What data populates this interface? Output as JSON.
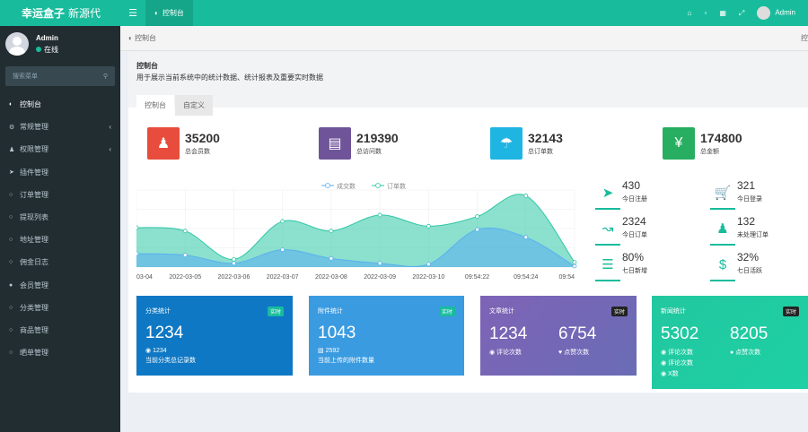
{
  "brand": {
    "name_bold": "幸运盒子",
    "name_light": "新源代"
  },
  "topbar": {
    "tab_label": "控制台",
    "user": "Admin"
  },
  "user": {
    "name": "Admin",
    "status": "在线"
  },
  "search": {
    "placeholder": "搜索菜单"
  },
  "sidebar": {
    "items": [
      {
        "label": "控制台",
        "icon": "dashboard-icon",
        "arrow": ""
      },
      {
        "label": "常规管理",
        "icon": "cogs-icon",
        "arrow": "‹"
      },
      {
        "label": "权限管理",
        "icon": "group-icon",
        "arrow": "‹"
      },
      {
        "label": "插件管理",
        "icon": "rocket-icon",
        "arrow": ""
      },
      {
        "label": "订单管理",
        "icon": "circle-icon",
        "arrow": ""
      },
      {
        "label": "提现列表",
        "icon": "circle-icon",
        "arrow": ""
      },
      {
        "label": "地址管理",
        "icon": "circle-icon",
        "arrow": ""
      },
      {
        "label": "佣金日志",
        "icon": "circle-icon",
        "arrow": ""
      },
      {
        "label": "会员管理",
        "icon": "user-icon",
        "arrow": ""
      },
      {
        "label": "分类管理",
        "icon": "circle-icon",
        "arrow": ""
      },
      {
        "label": "商品管理",
        "icon": "circle-icon",
        "arrow": ""
      },
      {
        "label": "晒单管理",
        "icon": "circle-icon",
        "arrow": ""
      }
    ]
  },
  "breadcrumb": {
    "label": "控制台",
    "right": "控"
  },
  "panel": {
    "title": "控制台",
    "desc": "用于展示当前系统中的统计数据、统计报表及重要实时数据",
    "tabs": [
      "控制台",
      "自定义"
    ]
  },
  "stats": [
    {
      "value": "35200",
      "label": "总会员数",
      "color": "#e74c3c",
      "icon": "users-icon"
    },
    {
      "value": "219390",
      "label": "总访问数",
      "color": "#6f5499",
      "icon": "book-icon"
    },
    {
      "value": "32143",
      "label": "总订单数",
      "color": "#1fb5e3",
      "icon": "shopping-bag-icon"
    },
    {
      "value": "174800",
      "label": "总金额",
      "color": "#27ae60",
      "icon": "yen-icon"
    }
  ],
  "chart_data": {
    "type": "area",
    "legend": [
      "成交数",
      "订单数"
    ],
    "x": [
      "03-04",
      "2022-03-05",
      "2022-03-06",
      "2022-03-07",
      "2022-03-08",
      "2022-03-09",
      "2022-03-10",
      "09:54:22",
      "09:54:24",
      "09:54"
    ],
    "series": [
      {
        "name": "成交数",
        "values": [
          28,
          25,
          8,
          36,
          18,
          8,
          6,
          78,
          62,
          2
        ],
        "color": "#5ab1ef"
      },
      {
        "name": "订单数",
        "values": [
          82,
          75,
          16,
          95,
          75,
          108,
          85,
          105,
          148,
          10
        ],
        "color": "#2ec7a5"
      }
    ],
    "ylim": [
      0,
      160
    ]
  },
  "mini_stats": [
    {
      "value": "430",
      "label": "今日注册",
      "icon": "rocket-icon"
    },
    {
      "value": "321",
      "label": "今日登录",
      "icon": "cart-icon"
    },
    {
      "value": "2324",
      "label": "今日订单",
      "icon": "line-chart-icon"
    },
    {
      "value": "132",
      "label": "未处理订单",
      "icon": "users-icon"
    },
    {
      "value": "80%",
      "label": "七日新增",
      "icon": "list-icon"
    },
    {
      "value": "32%",
      "label": "七日活跃",
      "icon": "dollar-icon"
    }
  ],
  "cards": [
    {
      "title": "分类统计",
      "badge": "实时",
      "big": "1234",
      "sub1": "1234",
      "sub2": "当前分类总记录数",
      "bg": "#0f78c4"
    },
    {
      "title": "附件统计",
      "badge": "实时",
      "big": "1043",
      "sub1": "2592",
      "sub2": "当前上传的附件数量",
      "bg": "#3a9be0"
    },
    {
      "title": "文章统计",
      "badge": "实时",
      "big1": "1234",
      "big2": "6754",
      "lbl1": "评论次数",
      "lbl2": "点赞次数",
      "bg": "#6f62b3"
    },
    {
      "title": "新闻统计",
      "badge": "实时",
      "big1": "5302",
      "big2": "8205",
      "lbl1": "评论次数",
      "lbl2": "点赞次数",
      "lbl3": "评论次数",
      "lbl4": "X数",
      "bg": "#1fc9a0"
    }
  ]
}
